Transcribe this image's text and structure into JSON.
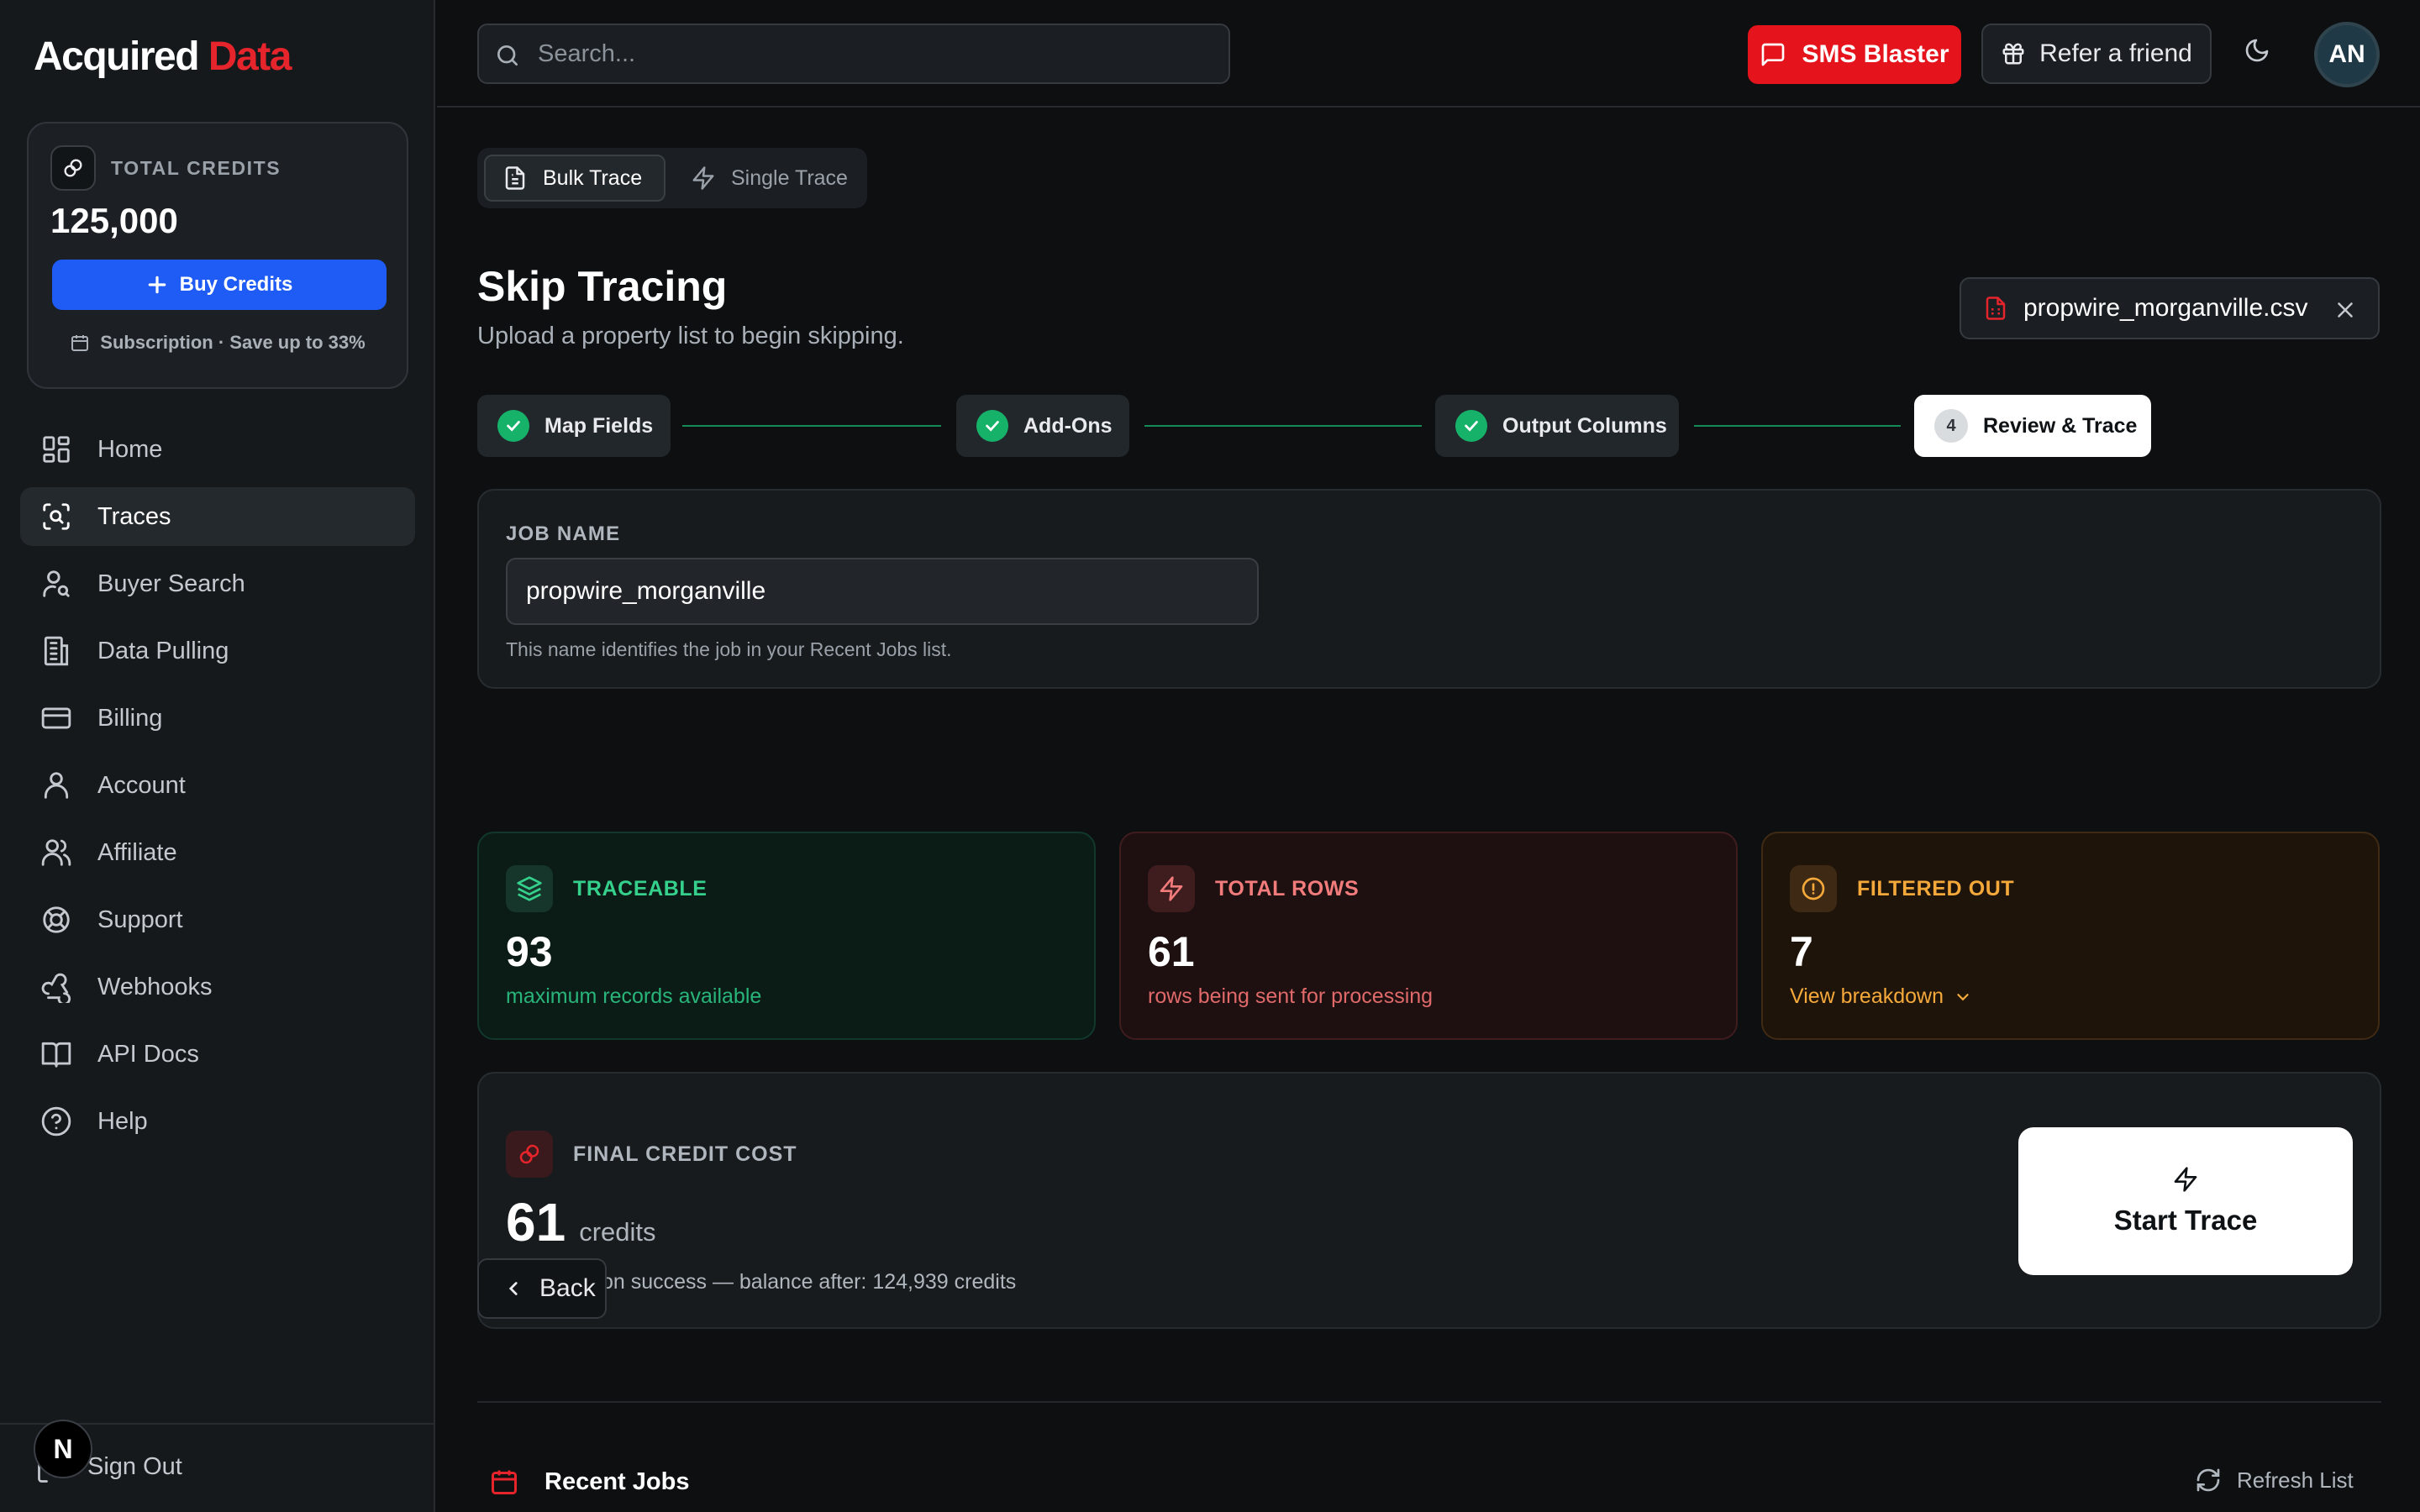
{
  "app": {
    "logo_main": "Acquired",
    "logo_accent": "Data"
  },
  "sidebar": {
    "credits_label": "TOTAL CREDITS",
    "credits_value": "125,000",
    "buy_label": "Buy Credits",
    "subscription_text": "Subscription · Save up to 33%",
    "items": [
      {
        "label": "Home",
        "icon": "grid-icon"
      },
      {
        "label": "Traces",
        "icon": "scan-search-icon",
        "active": true
      },
      {
        "label": "Buyer Search",
        "icon": "user-search-icon"
      },
      {
        "label": "Data Pulling",
        "icon": "building-icon"
      },
      {
        "label": "Billing",
        "icon": "credit-card-icon"
      },
      {
        "label": "Account",
        "icon": "user-icon"
      },
      {
        "label": "Affiliate",
        "icon": "users-icon"
      },
      {
        "label": "Support",
        "icon": "life-buoy-icon"
      },
      {
        "label": "Webhooks",
        "icon": "webhook-icon"
      },
      {
        "label": "API Docs",
        "icon": "book-icon"
      },
      {
        "label": "Help",
        "icon": "help-circle-icon"
      }
    ],
    "signout_label": "Sign Out",
    "badge_letter": "N"
  },
  "header": {
    "search_placeholder": "Search...",
    "sms_label": "SMS Blaster",
    "refer_label": "Refer a friend",
    "avatar_initials": "AN"
  },
  "main": {
    "tabs": [
      {
        "label": "Bulk Trace",
        "active": true
      },
      {
        "label": "Single Trace",
        "active": false
      }
    ],
    "title": "Skip Tracing",
    "subtitle": "Upload a property list to begin skipping.",
    "file_name": "propwire_morganville.csv",
    "steps": [
      {
        "label": "Map Fields",
        "done": true
      },
      {
        "label": "Add-Ons",
        "done": true
      },
      {
        "label": "Output Columns",
        "done": true
      },
      {
        "label": "Review & Trace",
        "number": "4",
        "current": true
      }
    ],
    "job": {
      "label": "JOB NAME",
      "value": "propwire_morganville",
      "hint": "This name identifies the job in your Recent Jobs list."
    },
    "stats": {
      "traceable": {
        "label": "TRACEABLE",
        "value": "93",
        "sub": "maximum records available"
      },
      "total_rows": {
        "label": "TOTAL ROWS",
        "value": "61",
        "sub": "rows being sent for processing"
      },
      "filtered": {
        "label": "FILTERED OUT",
        "value": "7",
        "link": "View breakdown"
      }
    },
    "cost": {
      "label": "FINAL CREDIT COST",
      "value": "61",
      "unit": "credits",
      "note": "Reserved on success — balance after: 124,939 credits",
      "start_label": "Start Trace"
    },
    "back_label": "Back",
    "recent_title": "Recent Jobs",
    "refresh_label": "Refresh List"
  },
  "colors": {
    "brand_red": "#e5242b",
    "primary_blue": "#1e5cf5",
    "success_green": "#17b26a",
    "warning_orange": "#f5a93b"
  }
}
